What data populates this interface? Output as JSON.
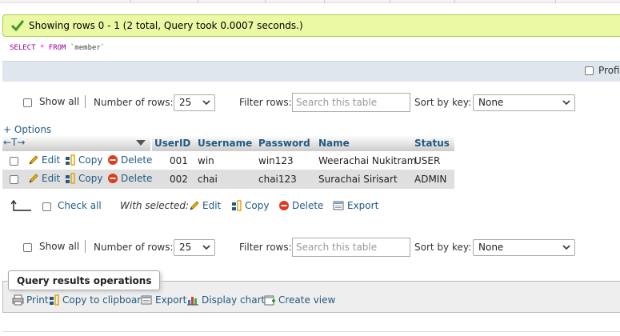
{
  "message": {
    "text": "Showing rows 0 - 1 (2 total, Query took 0.0007 seconds.)"
  },
  "sql": {
    "select": "SELECT",
    "star": "*",
    "from": "FROM",
    "table": "`member`"
  },
  "profiling": {
    "label": "Profiling"
  },
  "nav": {
    "show_all": "Show all",
    "number_of_rows_label": "Number of rows:",
    "number_of_rows_value": "25",
    "filter_label": "Filter rows:",
    "filter_placeholder": "Search this table",
    "sort_label": "Sort by key:",
    "sort_value": "None"
  },
  "options_link": "+ Options",
  "table": {
    "resize_arrows": "←T→",
    "columns": [
      "UserID",
      "Username",
      "Password",
      "Name",
      "Status"
    ],
    "row_actions": {
      "edit": "Edit",
      "copy": "Copy",
      "delete": "Delete"
    },
    "rows": [
      {
        "UserID": "001",
        "Username": "win",
        "Password": "win123",
        "Name": "Weerachai Nukitram",
        "Status": "USER"
      },
      {
        "UserID": "002",
        "Username": "chai",
        "Password": "chai123",
        "Name": "Surachai Sirisart",
        "Status": "ADMIN"
      }
    ]
  },
  "bulk": {
    "check_all": "Check all",
    "with_selected": "With selected:",
    "edit": "Edit",
    "copy": "Copy",
    "delete": "Delete",
    "export": "Export"
  },
  "operations": {
    "legend": "Query results operations",
    "print": "Print",
    "copy_clipboard": "Copy to clipboard",
    "export": "Export",
    "display_chart": "Display chart",
    "create_view": "Create view"
  },
  "colors": {
    "link": "#235a81",
    "success_bg": "#ebf8a4",
    "delete_red": "#e03a1e"
  },
  "icons": [
    "success-check-icon",
    "pencil-icon",
    "copy-icon",
    "delete-icon",
    "export-icon",
    "print-icon",
    "chart-icon",
    "create-view-icon",
    "arrow-up-left-icon",
    "dropdown-arrow-icon"
  ]
}
